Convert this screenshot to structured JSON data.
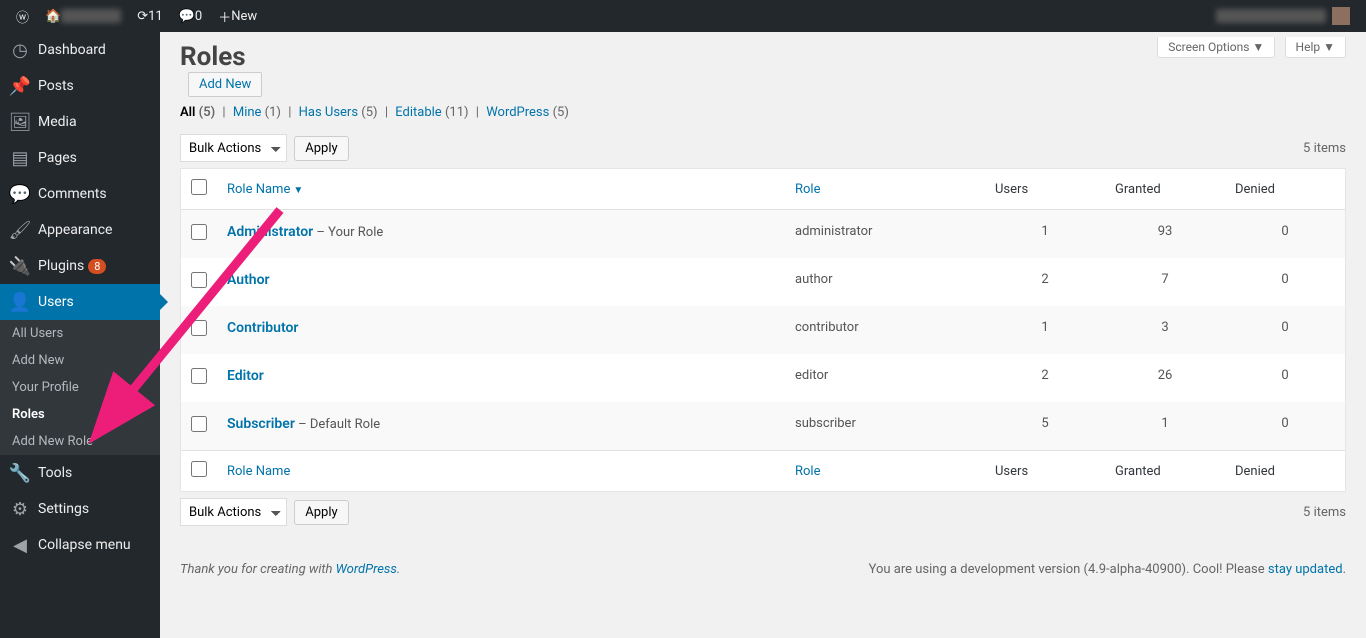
{
  "adminbar": {
    "updates_count": "11",
    "comments_count": "0",
    "new_label": "New"
  },
  "sidebar": {
    "dashboard": "Dashboard",
    "posts": "Posts",
    "media": "Media",
    "pages": "Pages",
    "comments": "Comments",
    "appearance": "Appearance",
    "plugins": "Plugins",
    "plugins_badge": "8",
    "users": "Users",
    "tools": "Tools",
    "settings": "Settings",
    "collapse": "Collapse menu",
    "submenu": {
      "all_users": "All Users",
      "add_new": "Add New",
      "your_profile": "Your Profile",
      "roles": "Roles",
      "add_new_role": "Add New Role"
    }
  },
  "header": {
    "screen_options": "Screen Options",
    "help": "Help",
    "title": "Roles",
    "add_new": "Add New"
  },
  "filters": {
    "all_label": "All",
    "all_count": "(5)",
    "mine_label": "Mine",
    "mine_count": "(1)",
    "has_users_label": "Has Users",
    "has_users_count": "(5)",
    "editable_label": "Editable",
    "editable_count": "(11)",
    "wordpress_label": "WordPress",
    "wordpress_count": "(5)"
  },
  "bulk": {
    "label": "Bulk Actions",
    "apply": "Apply"
  },
  "items_text": "5 items",
  "columns": {
    "role_name": "Role Name",
    "role": "Role",
    "users": "Users",
    "granted": "Granted",
    "denied": "Denied"
  },
  "rows": [
    {
      "name": "Administrator",
      "suffix": " – Your Role",
      "role": "administrator",
      "users": "1",
      "granted": "93",
      "denied": "0"
    },
    {
      "name": "Author",
      "suffix": "",
      "role": "author",
      "users": "2",
      "granted": "7",
      "denied": "0"
    },
    {
      "name": "Contributor",
      "suffix": "",
      "role": "contributor",
      "users": "1",
      "granted": "3",
      "denied": "0"
    },
    {
      "name": "Editor",
      "suffix": "",
      "role": "editor",
      "users": "2",
      "granted": "26",
      "denied": "0"
    },
    {
      "name": "Subscriber",
      "suffix": " – Default Role",
      "role": "subscriber",
      "users": "5",
      "granted": "1",
      "denied": "0"
    }
  ],
  "footer": {
    "thank_you_pre": "Thank you for creating with ",
    "wordpress": "WordPress",
    "dev_version_pre": "You are using a development version (4.9-alpha-40900). Cool! Please ",
    "stay_updated": "stay updated"
  }
}
